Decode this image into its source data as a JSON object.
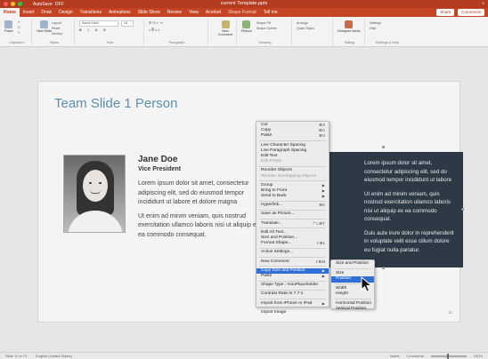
{
  "window": {
    "title": "current Template.pptx",
    "autosave": "AutoSave",
    "autosave_state": "OFF",
    "share_label": "Share",
    "comments_label": "Comments"
  },
  "tabs": [
    "Home",
    "Insert",
    "Draw",
    "Design",
    "Transitions",
    "Animations",
    "Slide Show",
    "Review",
    "View",
    "Acrobat",
    "Shape Format",
    "Tell me"
  ],
  "active_tab": "Home",
  "ribbon": {
    "paste": "Paste",
    "new_slide": "New Slide",
    "reset": "Reset",
    "section": "Section",
    "layout": "Layout",
    "font_name": "Avenir Next",
    "font_size": "18",
    "new_comment": "New Comment",
    "picture": "Picture",
    "shape_fill": "Shape Fill",
    "shape_outline": "Shape Outline",
    "quick_styles": "Quick Styles",
    "convert": "Convert to SmartArt",
    "arrange": "Arrange",
    "designer": "Designer Ideas",
    "settings": "Settings",
    "help": "Help",
    "group_labels": [
      "Clipboard",
      "Slides",
      "Font",
      "Paragraph",
      "Drawing",
      "Editing",
      "Settings & Help"
    ]
  },
  "slide": {
    "title": "Team Slide 1 Person",
    "name": "Jane Doe",
    "role": "Vice President",
    "bio": [
      "Lorem ipsum dolor sit amet, consectetur adipiscing elit, sed do eiusmod tempor incididunt ut labore et dolore magna",
      "Ut enim ad minim veniam, quis nostrud exercitation ullamco laboris nisi ut aliquip ex ea commodo consequat."
    ],
    "box_text": [
      "Lorem ipsum dolor sit amet, consectetur adipiscing elit, sed do eiusmod tempor incididunt ut labore",
      "Ut enim ad minim veniam, quis nostrud exercitation ullamco laboris nisi ut aliquip ex ea commodo consequat.",
      "Duis aute irure dolor in reprehenderit in voluptate velit esse cillum dolore eu fugiat nulla pariatur."
    ],
    "slide_number": "11"
  },
  "context_menu": [
    {
      "label": "Cut",
      "shortcut": "⌘X"
    },
    {
      "label": "Copy",
      "shortcut": "⌘C"
    },
    {
      "label": "Paste",
      "shortcut": "⌘V"
    },
    {
      "sep": true
    },
    {
      "label": "Live Character Spacing"
    },
    {
      "label": "Live Paragraph Spacing"
    },
    {
      "label": "Edit Text"
    },
    {
      "label": "Edit Points",
      "disabled": true
    },
    {
      "sep": true
    },
    {
      "label": "Reorder Objects"
    },
    {
      "label": "Reorder Overlapping Objects",
      "disabled": true
    },
    {
      "sep": true
    },
    {
      "label": "Group",
      "shortcut": "▶"
    },
    {
      "label": "Bring to Front",
      "shortcut": "▶"
    },
    {
      "label": "Send to Back",
      "shortcut": "▶"
    },
    {
      "sep": true
    },
    {
      "label": "Hyperlink...",
      "shortcut": "⌘K"
    },
    {
      "sep": true
    },
    {
      "label": "Save as Picture..."
    },
    {
      "sep": true
    },
    {
      "label": "Translate...",
      "shortcut": "^⌥⌘T"
    },
    {
      "sep": true
    },
    {
      "label": "Edit Alt Text..."
    },
    {
      "label": "Size and Position..."
    },
    {
      "label": "Format Shape...",
      "shortcut": "⇧⌘1"
    },
    {
      "sep": true
    },
    {
      "label": "Action Settings..."
    },
    {
      "sep": true
    },
    {
      "label": "New Comment",
      "shortcut": "⇧⌘M"
    },
    {
      "sep": true
    },
    {
      "label": "Copy Size and Position",
      "shortcut": "▶",
      "highlight": true
    },
    {
      "label": "Paste",
      "shortcut": "▶"
    },
    {
      "sep": true
    },
    {
      "label": "Shape Type : mooPlaceholder"
    },
    {
      "sep": true
    },
    {
      "label": "Contrast Ratio is 7.7:1"
    },
    {
      "sep": true
    },
    {
      "label": "Import from iPhone or iPad",
      "shortcut": "▶"
    },
    {
      "sep": true
    },
    {
      "label": "Import Image"
    }
  ],
  "submenu": [
    {
      "label": "Size and Position"
    },
    {
      "sep": true
    },
    {
      "label": "Size"
    },
    {
      "label": "Position",
      "highlight": true
    },
    {
      "sep": true
    },
    {
      "label": "Width"
    },
    {
      "label": "Height"
    },
    {
      "sep": true
    },
    {
      "label": "Horizontal Position"
    },
    {
      "label": "Vertical Position"
    }
  ],
  "status": {
    "slide_info": "Slide 11 of 72",
    "language": "English (United States)",
    "notes": "Notes",
    "comments": "Comments",
    "zoom": "100%"
  },
  "colors": {
    "brand": "#c44424",
    "title_blue": "#5a8fb2",
    "box": "#2d3a46",
    "highlight": "#2f6fd6"
  }
}
